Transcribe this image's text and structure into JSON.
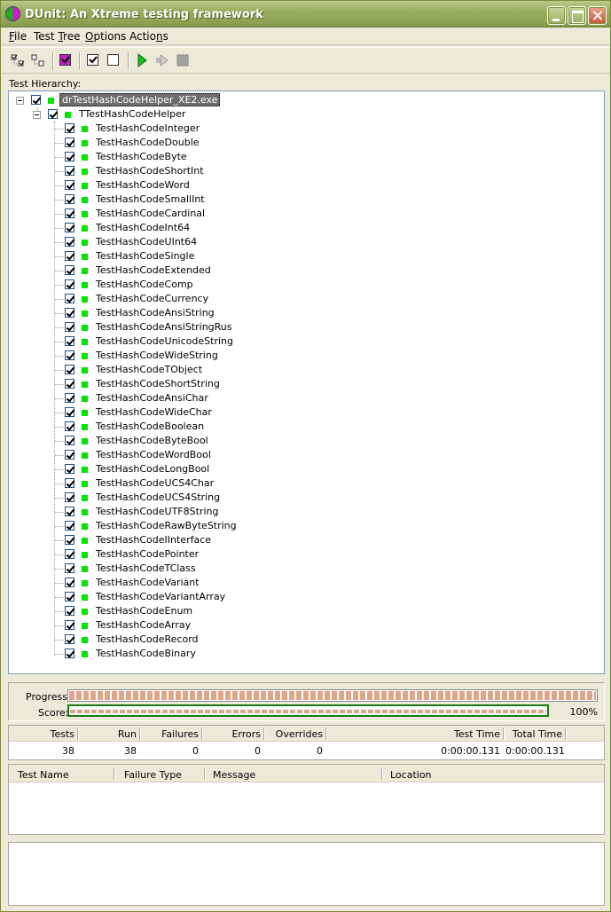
{
  "window": {
    "title": "DUnit: An Xtreme testing framework"
  },
  "menu": [
    {
      "pre": "",
      "u": "F",
      "post": "ile"
    },
    {
      "pre": "Test ",
      "u": "T",
      "post": "ree"
    },
    {
      "pre": "",
      "u": "O",
      "post": "ptions"
    },
    {
      "pre": "Actio",
      "u": "n",
      "post": "s"
    }
  ],
  "toolbar_icons": [
    "select-all-icon",
    "deselect-all-icon",
    "select-failed-icon",
    "check-icon",
    "uncheck-icon",
    "run-icon",
    "run-selected-icon",
    "stop-icon"
  ],
  "hierarchy_label": "Test Hierarchy:",
  "tree": {
    "root": "drTestHashCodeHelper_XE2.exe",
    "suite": "TTestHashCodeHelper",
    "tests": [
      "TestHashCodeInteger",
      "TestHashCodeDouble",
      "TestHashCodeByte",
      "TestHashCodeShortInt",
      "TestHashCodeWord",
      "TestHashCodeSmallInt",
      "TestHashCodeCardinal",
      "TestHashCodeInt64",
      "TestHashCodeUInt64",
      "TestHashCodeSingle",
      "TestHashCodeExtended",
      "TestHashCodeComp",
      "TestHashCodeCurrency",
      "TestHashCodeAnsiString",
      "TestHashCodeAnsiStringRus",
      "TestHashCodeUnicodeString",
      "TestHashCodeWideString",
      "TestHashCodeTObject",
      "TestHashCodeShortString",
      "TestHashCodeAnsiChar",
      "TestHashCodeWideChar",
      "TestHashCodeBoolean",
      "TestHashCodeByteBool",
      "TestHashCodeWordBool",
      "TestHashCodeLongBool",
      "TestHashCodeUCS4Char",
      "TestHashCodeUCS4String",
      "TestHashCodeUTF8String",
      "TestHashCodeRawByteString",
      "TestHashCodeIInterface",
      "TestHashCodePointer",
      "TestHashCodeTClass",
      "TestHashCodeVariant",
      "TestHashCodeVariantArray",
      "TestHashCodeEnum",
      "TestHashCodeArray",
      "TestHashCodeRecord",
      "TestHashCodeBinary"
    ],
    "status_color": "#00e400"
  },
  "progress": {
    "label": "Progress:",
    "value": 1.0
  },
  "score": {
    "label": "Score:",
    "value": 1.0,
    "text": "100%"
  },
  "stats": {
    "headers": [
      "Tests",
      "Run",
      "Failures",
      "Errors",
      "Overrides",
      "Test Time",
      "Total Time"
    ],
    "values": [
      "38",
      "38",
      "0",
      "0",
      "0",
      "0:00:00.131",
      "0:00:00.131"
    ]
  },
  "failures": {
    "headers": [
      "Test Name",
      "Failure Type",
      "Message",
      "Location"
    ]
  }
}
